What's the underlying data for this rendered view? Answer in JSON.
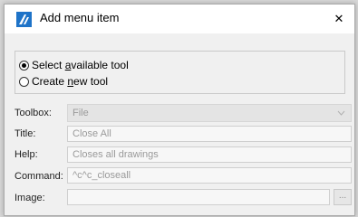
{
  "window": {
    "title": "Add menu item",
    "close_symbol": "✕",
    "icon": "app-logo-icon",
    "accent": "#1e73c8"
  },
  "mode": {
    "option_select": {
      "prefix": "Select ",
      "accel": "a",
      "suffix": "vailable tool",
      "checked": true
    },
    "option_create": {
      "prefix": "Create ",
      "accel": "n",
      "suffix": "ew tool",
      "checked": false
    }
  },
  "form": {
    "toolbox_label": "Toolbox:",
    "toolbox_value": "File",
    "title_label": "Title:",
    "title_value": "Close All",
    "help_label": "Help:",
    "help_value": "Closes all drawings",
    "command_label": "Command:",
    "command_value": "^c^c_closeall",
    "image_label": "Image:",
    "image_value": "",
    "browse_label": "..."
  }
}
